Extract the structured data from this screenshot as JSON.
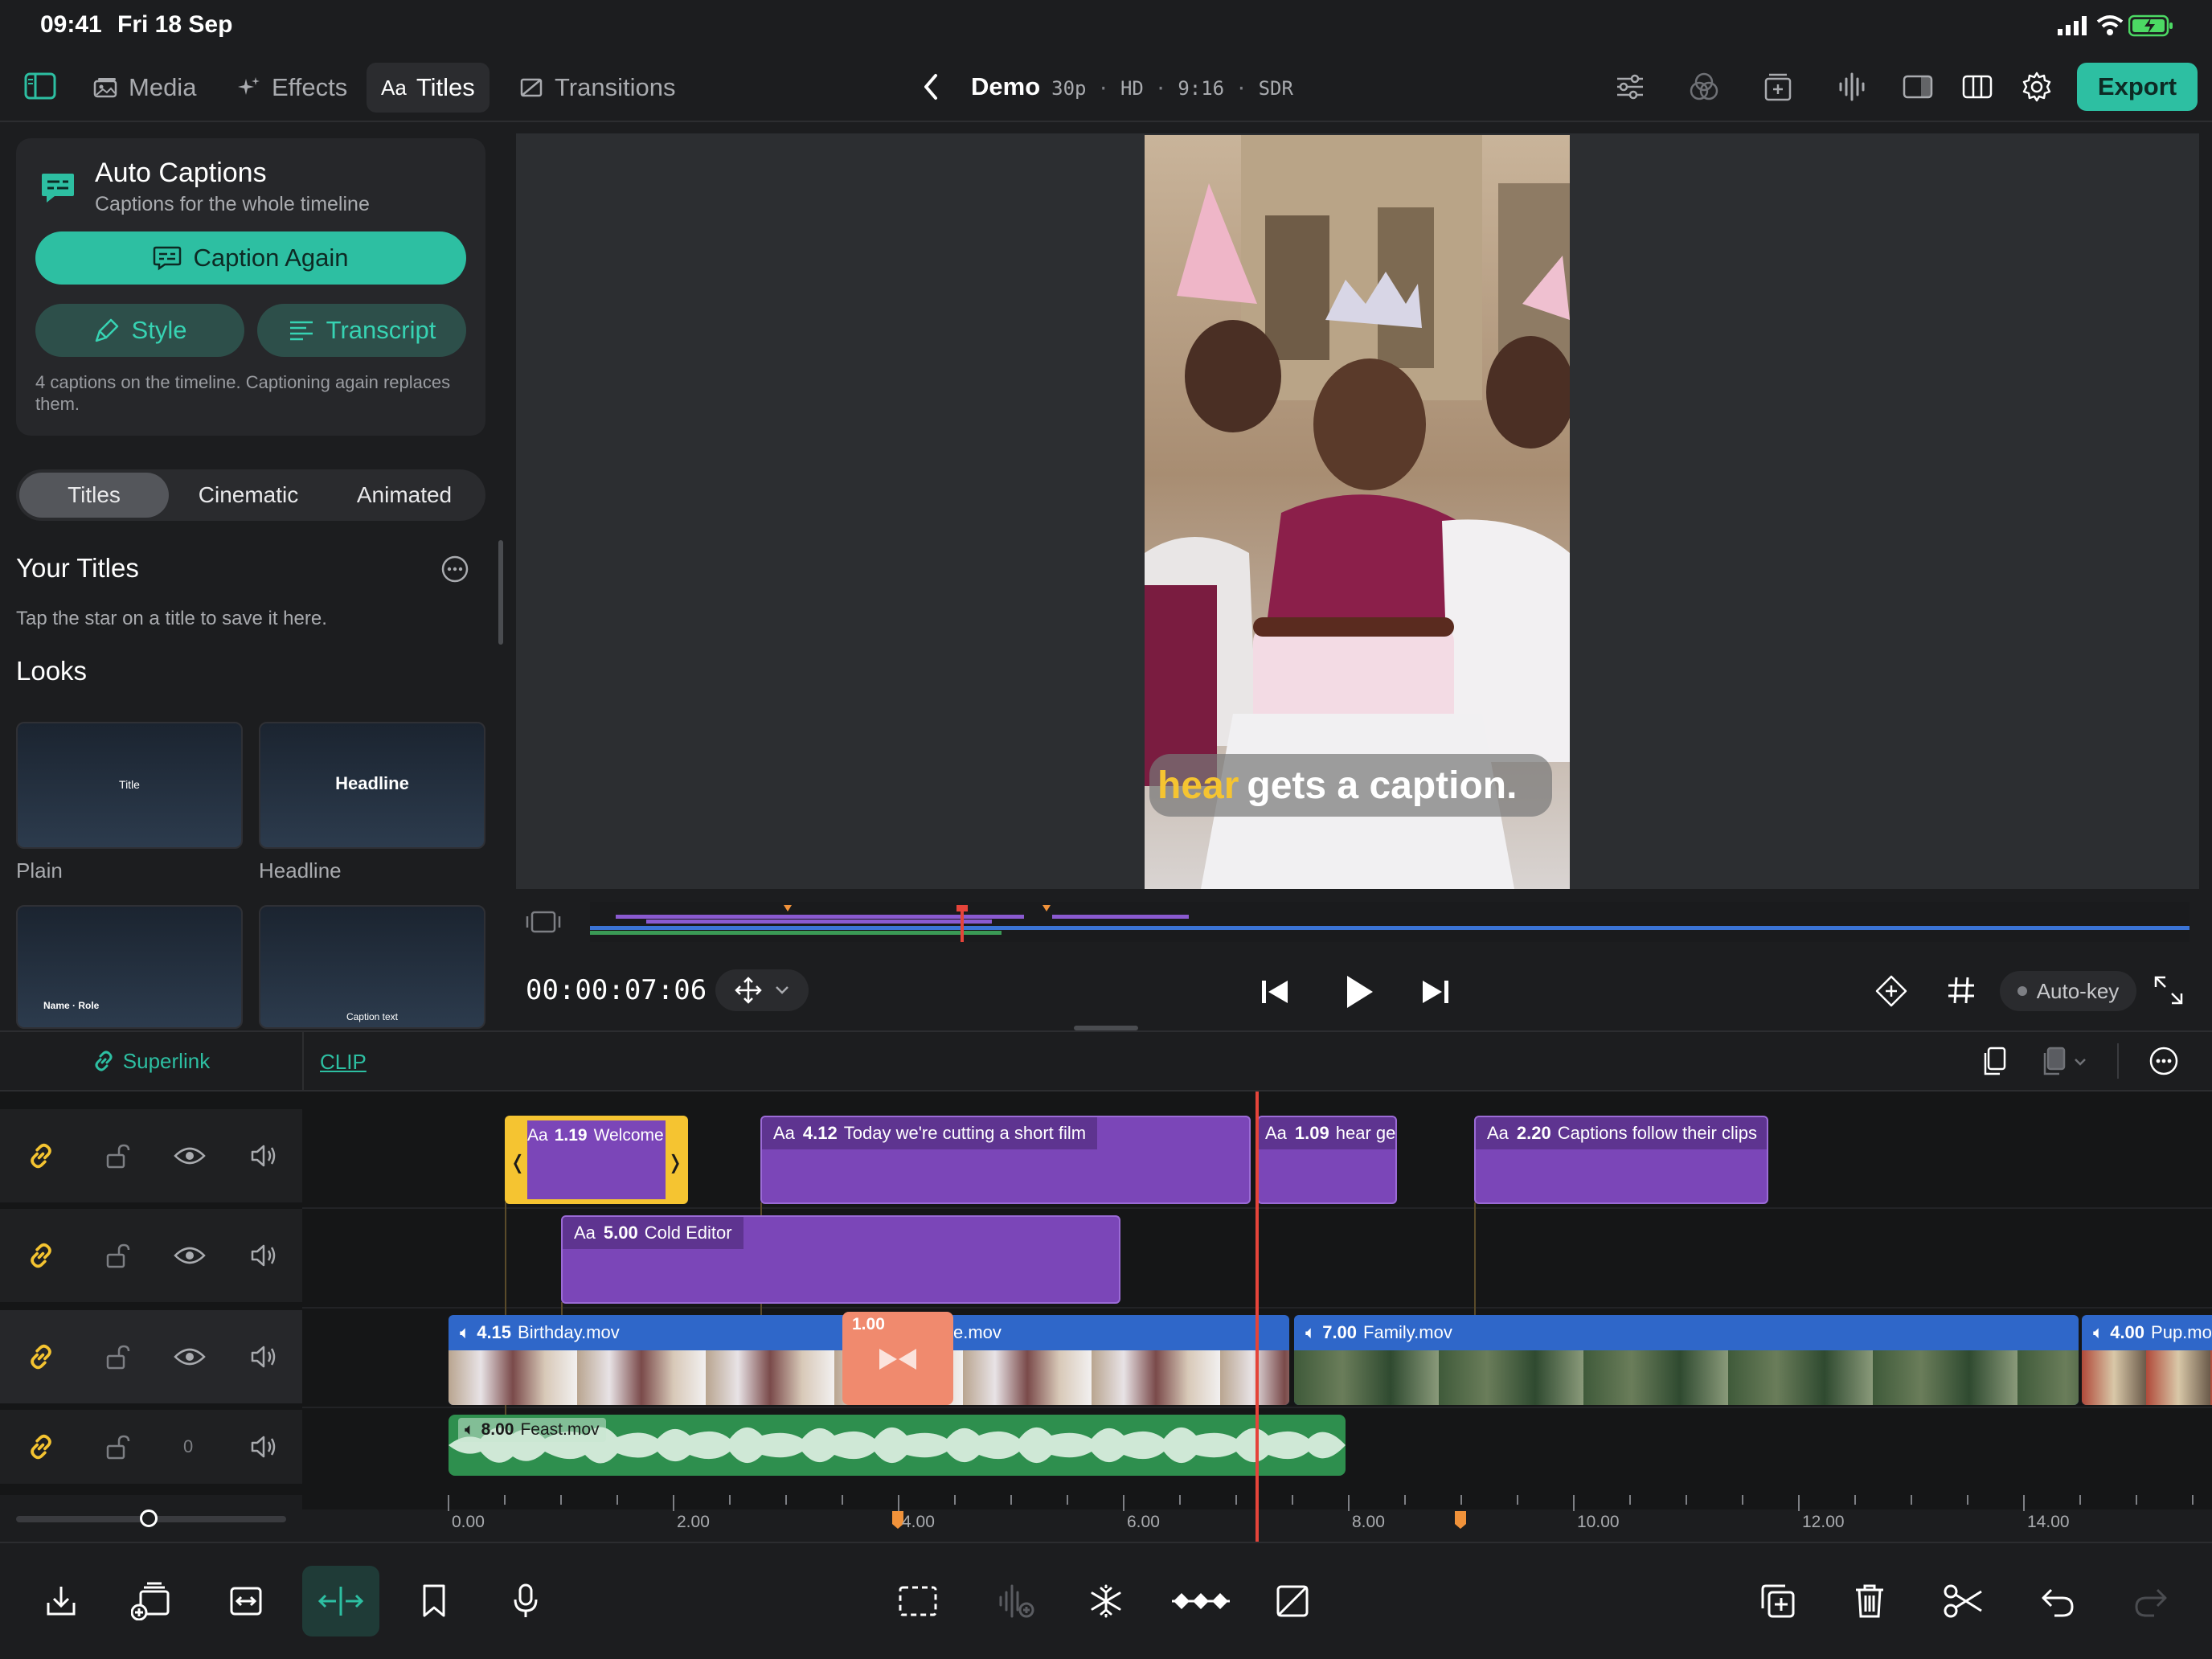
{
  "status": {
    "time": "09:41",
    "date": "Fri 18 Sep"
  },
  "topbar": {
    "tabs": [
      {
        "label": "Media",
        "icon": "media-icon"
      },
      {
        "label": "Effects",
        "icon": "effects-icon"
      },
      {
        "label": "Titles",
        "icon": "titles-icon"
      },
      {
        "label": "Transitions",
        "icon": "transitions-icon"
      }
    ],
    "titles_glyph": "Aa",
    "project": {
      "name": "Demo",
      "fps": "30p",
      "res": "HD",
      "aspect": "9:16",
      "range": "SDR",
      "sep": "·"
    },
    "export_label": "Export"
  },
  "left": {
    "auto_captions": {
      "title": "Auto Captions",
      "subtitle": "Captions for the whole timeline",
      "caption_again": "Caption Again",
      "style": "Style",
      "transcript": "Transcript",
      "note": "4 captions on the timeline. Captioning again replaces them."
    },
    "segments": [
      "Titles",
      "Cinematic",
      "Animated"
    ],
    "your_titles": {
      "heading": "Your Titles",
      "hint": "Tap the star on a title to save it here."
    },
    "looks": {
      "heading": "Looks",
      "items": [
        {
          "name": "Plain",
          "preview_text": "Title"
        },
        {
          "name": "Headline",
          "preview_text": "Headline"
        },
        {
          "name": "",
          "preview_text": "Name · Role"
        },
        {
          "name": "",
          "preview_text": "Caption text"
        }
      ]
    }
  },
  "preview": {
    "caption_highlight": "hear",
    "caption_rest": "gets a caption.",
    "accent_yellow": "#f5c431"
  },
  "transport": {
    "timecode": "00:00:07:06",
    "autokey": "Auto-key"
  },
  "timeline": {
    "superlink": "Superlink",
    "clip_tab": "CLIP",
    "track_titles": [
      {
        "glyph": "Aa",
        "dur": "1.19",
        "name": "Welcome b"
      },
      {
        "glyph": "Aa",
        "dur": "4.12",
        "name": "Today we're cutting a short film"
      },
      {
        "glyph": "Aa",
        "dur": "1.09",
        "name": "hear ge"
      },
      {
        "glyph": "Aa",
        "dur": "2.20",
        "name": "Captions follow their clips"
      },
      {
        "glyph": "Aa",
        "dur": "5.00",
        "name": "Cold Editor"
      }
    ],
    "video_clips": [
      {
        "dur": "4.15",
        "name": "Birthday.mov"
      },
      {
        "dur": "",
        "name": "e.mov"
      },
      {
        "dur": "7.00",
        "name": "Family.mov"
      },
      {
        "dur": "4.00",
        "name": "Pup.mo"
      }
    ],
    "transition_dur": "1.00",
    "audio_clip": {
      "dur": "8.00",
      "name": "Feast.mov"
    },
    "audio_track_volume": "0",
    "ruler": [
      "0.00",
      "2.00",
      "4.00",
      "6.00",
      "8.00",
      "10.00",
      "12.00",
      "14.00"
    ],
    "zoom_level": 0.49
  },
  "colors": {
    "teal": "#2dbfa2",
    "purple_clip": "#7b46b8",
    "blue_clip": "#2f67c9",
    "green_audio": "#2e8f4e",
    "playhead": "#e5443a",
    "transition": "#f08a6e",
    "link_yellow": "#f5c431"
  }
}
